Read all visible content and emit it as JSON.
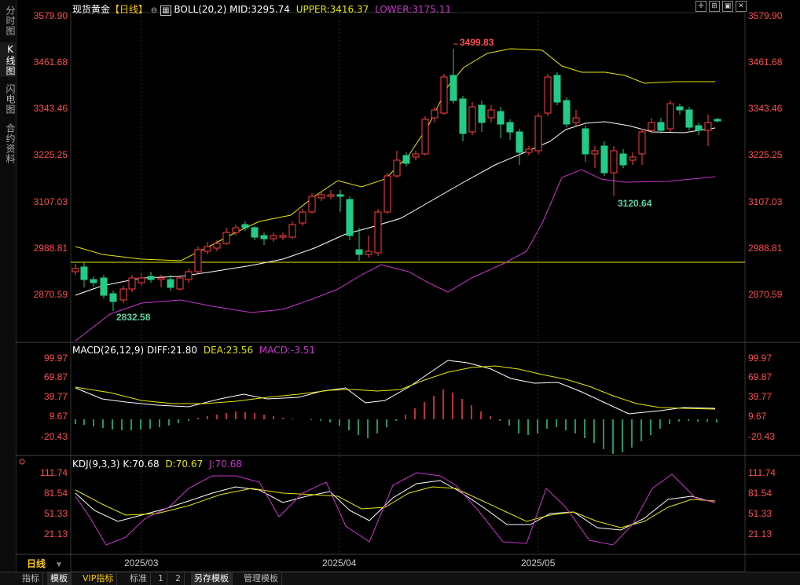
{
  "sidebar": {
    "tabs": [
      {
        "label": "分时图",
        "active": false
      },
      {
        "label": "K线图",
        "active": true
      },
      {
        "label": "闪电图",
        "active": false
      },
      {
        "label": "合约资料",
        "active": false
      }
    ]
  },
  "header": {
    "title": "现货黄金",
    "period": "【日线】",
    "boll_label": "BOLL(20,2)",
    "mid": "MID:3295.74",
    "upper": "UPPER:3416.37",
    "lower": "LOWER:3175.11"
  },
  "macd": {
    "label": "MACD(26,12,9)",
    "diff": "DIFF:21.80",
    "dea": "DEA:23.56",
    "macd": "MACD:-3.51"
  },
  "kdj": {
    "label": "KDJ(9,3,3)",
    "k": "K:70.68",
    "d": "D:70.67",
    "j": "J:70.68"
  },
  "price_axis": [
    "3579.90",
    "3461.68",
    "3343.46",
    "3225.25",
    "3107.03",
    "2988.81",
    "2870.59"
  ],
  "macd_axis": [
    "99.97",
    "69.87",
    "39.77",
    "9.67",
    "-20.43"
  ],
  "kdj_axis": [
    "111.74",
    "81.54",
    "51.33",
    "21.13"
  ],
  "annotations": {
    "high": "3499.83",
    "low": "2832.58",
    "mid_low": "3120.64"
  },
  "x_labels": [
    "2025/03",
    "2025/04",
    "2025/05"
  ],
  "period_indicator": "日线",
  "bottom_tabs": [
    {
      "label": "指标",
      "active": false
    },
    {
      "label": "模板",
      "active": true
    },
    {
      "label": "VIP指标",
      "active": false
    },
    {
      "label": "标准",
      "active": false
    },
    {
      "label": "1",
      "active": false
    },
    {
      "label": "2",
      "active": false
    },
    {
      "label": "另存模板",
      "active": true
    },
    {
      "label": "管理模板",
      "active": false
    }
  ],
  "colors": {
    "up": "#ff4040",
    "down": "#22cc88",
    "upper_band": "#e6e600",
    "lower_band": "#cc33cc",
    "mid_band": "#ffffff",
    "dea": "#e6e600",
    "j_line": "#cc33cc",
    "axis_text": "#ff4d4d"
  }
}
